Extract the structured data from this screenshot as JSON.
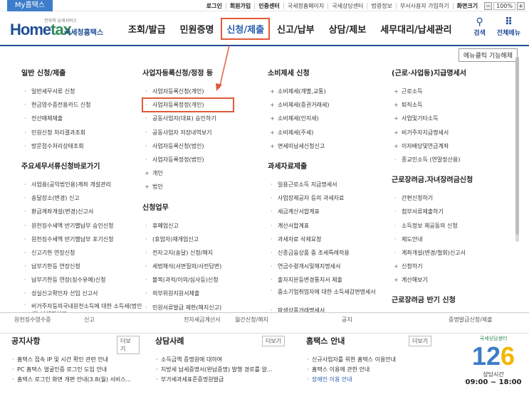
{
  "topbar": {
    "my_tab": "My홈택스",
    "links": [
      "로그인",
      "회원가입",
      "인증센터",
      "국세청홈페이지",
      "국세상담센터",
      "법령정보",
      "부서사용자 가입하기",
      "화면크기"
    ],
    "zoom_minus": "−",
    "zoom_value": "100%",
    "zoom_plus": "+"
  },
  "header": {
    "logo_home": "Home",
    "logo_tax": "tax",
    "logo_sub": "전자적 납세서비스",
    "logo_nts": "국세청홈택스",
    "nav": [
      "조회/발급",
      "민원증명",
      "신청/제출",
      "신고/납부",
      "상담/제보",
      "세무대리/납세관리"
    ],
    "search_label": "검색",
    "allmenu_label": "전체메뉴"
  },
  "mega": {
    "unpin": "메뉴클릭 기능해제",
    "col1": {
      "title": "일반 신청/제출",
      "items": [
        "일반세무서류 신청",
        "현금영수증전용카드 신청",
        "전산매체제출",
        "민원신청 처리결과조회",
        "방문접수처리상태조회"
      ],
      "title2": "주요세무서류신청바로가기",
      "items2": [
        "사업용(공익법인용)계좌 개설관리",
        "송달장소(변경) 신고",
        "환급계좌개설(변경)신고서",
        "원천징수세액 반기별납부 승인신청",
        "원천징수세액 반기별납부 포기신청",
        "신고기한 연장신청",
        "납부기한등 연장신청",
        "납부기한등 연장(징수유예)신청",
        "성실신고확인자 선임 신고서",
        "비거주자등의국내원천소득에 대한 소득세(법인세) 납세지신고"
      ]
    },
    "col2": {
      "title": "사업자등록신청/정정 등",
      "items": [
        "사업자등록신청(개인)",
        "사업자등록정정(개인)",
        "공동사업자(대표) 승인하기",
        "공동사업자 저장내역보기",
        "사업자등록신청(법인)",
        "사업자등록정정(법인)"
      ],
      "items_plus": [
        "개인",
        "법인"
      ],
      "title2": "신청업무",
      "items2": [
        "휴폐업신고",
        "(휴업자)재개업신고",
        "전자고지(송달) 신청/해지",
        "세법해석(서면질의/사전답변)",
        "불복(과적/이의/심사등)신청",
        "외부위원지원서제출",
        "민원서류발급 제한(해지신고)"
      ]
    },
    "col3": {
      "title": "소비제세 신청",
      "items": [
        "소비제세(개별,교통)",
        "소비제세(증권거래세)",
        "소비제세(인지세)",
        "소비제세(주세)",
        "면세미납세신청신고"
      ],
      "title2": "과세자료제출",
      "items2": [
        "일용근로소득 지급명세서",
        "사업장제공자 등의 과세자료",
        "세금계산서합계표",
        "계산서합계표",
        "과세자료 삭제요청",
        "신종금융상품 중 조세특례적용",
        "연금수령개시및해지명세서",
        "출자지분등변경통지서 제출",
        "중소기업취업자에 대한 소득세감면명세서",
        "파생상품거래명세서"
      ]
    },
    "col4": {
      "title": "(근로·사업등)지급명세서",
      "items": [
        "근로소득",
        "퇴직소득",
        "사업및기타소득",
        "비거주자지급명세서",
        "이자배당및연금계좌",
        "종교인소득 (연말정산용)"
      ],
      "title2": "근로장려금.자녀장려금신청",
      "items2": [
        "간편신청하기",
        "첨부서류제출하기",
        "소득정보 제공동의 신청",
        "제도안내",
        "계좌개설(변경/철회)신고서",
        "신청하기",
        "계산해보기"
      ],
      "title3": "근로장려금 반기 신청"
    }
  },
  "behind": [
    "원천징수영수증",
    "신고",
    "전자세금계산서",
    "월간신청/해지",
    "공지",
    "증명발급신청/제출"
  ],
  "bottom": {
    "notice": {
      "title": "공지사항",
      "more": "더보기",
      "items": [
        "홈택스 접속 IP 및 시간 확인 관련 안내",
        "PC 홈택스 얼굴인증 로그인 도입 안내",
        "홈택스 로그인 화면 개편 안내(3.8(월) 서비스..."
      ]
    },
    "cases": {
      "title": "상담사례",
      "more": "더보기",
      "items": [
        "소득금액 증명원에 대하여",
        "지방세 납세증명서(완납증명) 발행 경로를 알...",
        "부가세과세표준증명원발급"
      ]
    },
    "guide": {
      "title": "홈택스 안내",
      "more": "더보기",
      "items": [
        "신규사업자를 위한 홈택스 이용안내",
        "홈택스 이용에 관한 안내",
        "장애인 이용 안내"
      ]
    },
    "center": {
      "title": "국세상담센터",
      "num1": "12",
      "num2": "6",
      "hours_label": "상담시간",
      "hours": "09:00 ~ 18:00"
    }
  }
}
